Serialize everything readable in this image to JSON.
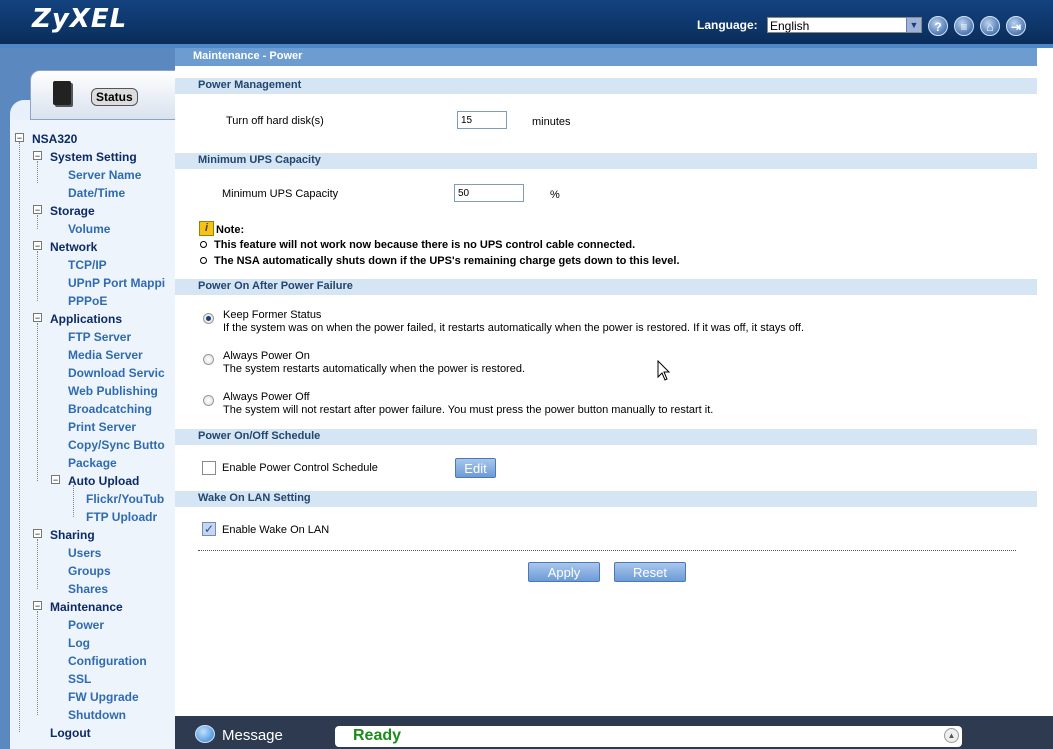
{
  "header": {
    "logo": "ZyXEL",
    "language_label": "Language:",
    "language_value": "English",
    "icons": [
      "help-icon",
      "sitemap-icon",
      "home-icon",
      "logout-icon"
    ]
  },
  "sidebar": {
    "status_tab": "Status",
    "tree": {
      "root": "NSA320",
      "groups": [
        {
          "label": "System Setting",
          "items": [
            "Server Name",
            "Date/Time"
          ]
        },
        {
          "label": "Storage",
          "items": [
            "Volume"
          ]
        },
        {
          "label": "Network",
          "items": [
            "TCP/IP",
            "UPnP Port Mappi",
            "PPPoE"
          ]
        },
        {
          "label": "Applications",
          "items": [
            "FTP Server",
            "Media Server",
            "Download Servic",
            "Web Publishing",
            "Broadcatching",
            "Print Server",
            "Copy/Sync Butto",
            "Package"
          ],
          "subgroup": {
            "label": "Auto Upload",
            "items": [
              "Flickr/YouTub",
              "FTP Uploadr"
            ]
          }
        },
        {
          "label": "Sharing",
          "items": [
            "Users",
            "Groups",
            "Shares"
          ]
        },
        {
          "label": "Maintenance",
          "items": [
            "Power",
            "Log",
            "Configuration",
            "SSL",
            "FW Upgrade",
            "Shutdown"
          ]
        }
      ],
      "logout": "Logout"
    }
  },
  "main": {
    "page_title": "Maintenance - Power",
    "power_mgmt": {
      "section": "Power Management",
      "label": "Turn off hard disk(s)",
      "value": "15",
      "unit": "minutes"
    },
    "ups": {
      "section": "Minimum UPS Capacity",
      "label": "Minimum UPS Capacity",
      "value": "50",
      "unit": "%"
    },
    "note": {
      "title": "Note:",
      "lines": [
        "This feature will not work now because there is no UPS control cable connected.",
        "The NSA automatically shuts down if the UPS's remaining charge gets down to this level."
      ]
    },
    "power_on": {
      "section": "Power On After Power Failure",
      "options": [
        {
          "label": "Keep Former Status",
          "desc": "If the system was on when the power failed, it restarts automatically when the power is restored. If it was off, it stays off.",
          "selected": true
        },
        {
          "label": "Always Power On",
          "desc": "The system restarts automatically when the power is restored.",
          "selected": false
        },
        {
          "label": "Always Power Off",
          "desc": "The system will not restart after power failure. You must press the power button manually to restart it.",
          "selected": false
        }
      ]
    },
    "schedule": {
      "section": "Power On/Off Schedule",
      "checkbox_label": "Enable Power Control Schedule",
      "checked": false,
      "edit_label": "Edit"
    },
    "wol": {
      "section": "Wake On LAN Setting",
      "checkbox_label": "Enable Wake On LAN",
      "checked": true
    },
    "apply_label": "Apply",
    "reset_label": "Reset"
  },
  "message_bar": {
    "label": "Message",
    "status": "Ready"
  }
}
